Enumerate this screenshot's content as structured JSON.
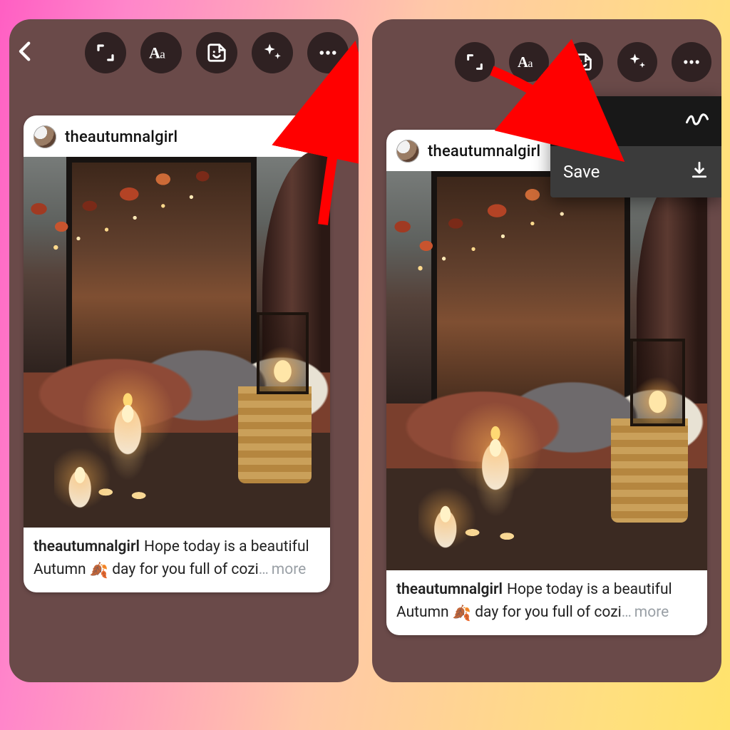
{
  "toolbar_icons": [
    "resize-icon",
    "text-icon",
    "sticker-icon",
    "sparkle-icon",
    "more-icon"
  ],
  "post": {
    "username": "theautumnalgirl",
    "caption_user": "theautumnalgirl",
    "caption_text_before": "Hope today is a beautiful Autumn ",
    "caption_emoji": "🍂",
    "caption_text_after": " day for you full of cozi",
    "ellipsis": "…",
    "more_label": "more"
  },
  "menu": {
    "draw_label": "Draw",
    "save_label": "Save"
  }
}
